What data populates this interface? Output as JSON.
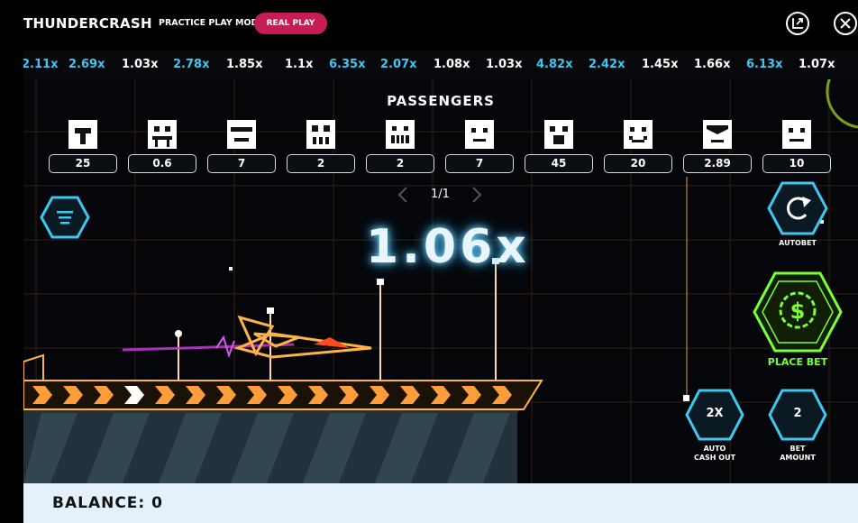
{
  "header": {
    "title": "THUNDERCRASH",
    "mode_label": "PRACTICE PLAY MODE",
    "real_play_label": "REAL PLAY"
  },
  "ticker": [
    {
      "label": "2.11x",
      "color": "#3ec7f0"
    },
    {
      "label": "2.69x",
      "color": "#3ec7f0"
    },
    {
      "label": "1.03x",
      "color": "#ffffff"
    },
    {
      "label": "2.78x",
      "color": "#3ec7f0"
    },
    {
      "label": "1.85x",
      "color": "#ffffff"
    },
    {
      "label": "1.1x",
      "color": "#ffffff"
    },
    {
      "label": "6.35x",
      "color": "#3ec7f0"
    },
    {
      "label": "2.07x",
      "color": "#3ec7f0"
    },
    {
      "label": "1.08x",
      "color": "#ffffff"
    },
    {
      "label": "1.03x",
      "color": "#ffffff"
    },
    {
      "label": "4.82x",
      "color": "#3ec7f0"
    },
    {
      "label": "2.42x",
      "color": "#3ec7f0"
    },
    {
      "label": "1.45x",
      "color": "#ffffff"
    },
    {
      "label": "1.66x",
      "color": "#ffffff"
    },
    {
      "label": "6.13x",
      "color": "#3ec7f0"
    },
    {
      "label": "1.07x",
      "color": "#ffffff"
    }
  ],
  "passengers": {
    "title": "PASSENGERS",
    "page_label": "1/1",
    "items": [
      {
        "value": "25",
        "face": "ghost-face-icon"
      },
      {
        "value": "0.6",
        "face": "robot-face-icon"
      },
      {
        "value": "7",
        "face": "visor-face-icon"
      },
      {
        "value": "2",
        "face": "skull-face-icon"
      },
      {
        "value": "2",
        "face": "grin-face-icon"
      },
      {
        "value": "7",
        "face": "plain-face-icon"
      },
      {
        "value": "45",
        "face": "shout-face-icon"
      },
      {
        "value": "20",
        "face": "smile-face-icon"
      },
      {
        "value": "2.89",
        "face": "mask-face-icon"
      },
      {
        "value": "10",
        "face": "neutral-face-icon"
      }
    ]
  },
  "game": {
    "multiplier": "1.06x"
  },
  "controls": {
    "autobet_label": "AUTOBET",
    "place_bet_label": "PLACE BET",
    "auto_cash_out_value": "2X",
    "auto_cash_out_label_1": "AUTO",
    "auto_cash_out_label_2": "CASH OUT",
    "bet_amount_value": "2",
    "bet_amount_label_1": "BET",
    "bet_amount_label_2": "AMOUNT"
  },
  "balance": {
    "label": "BALANCE: 0"
  },
  "colors": {
    "cyan_accent": "#3ec7f0",
    "green_accent": "#79ff3a",
    "orange_neon": "#ffb347",
    "real_play_pink": "#c71d55",
    "grid_orange": "#3a1f0a"
  }
}
